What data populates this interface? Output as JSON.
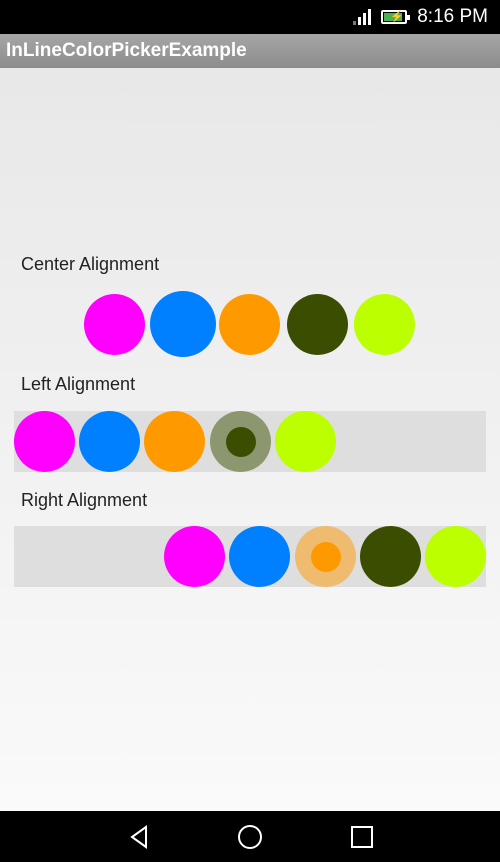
{
  "status_bar": {
    "time": "8:16 PM",
    "icons": [
      "signal-icon",
      "battery-charging-icon"
    ]
  },
  "app_bar": {
    "title": "InLineColorPickerExample"
  },
  "sections": [
    {
      "label": "Center Alignment",
      "alignment": "center",
      "colors": [
        "#ff00ff",
        "#0080ff",
        "#ff9900",
        "#3a4d00",
        "#bbff00"
      ],
      "selected": 1
    },
    {
      "label": "Left Alignment",
      "alignment": "left",
      "colors": [
        "#ff00ff",
        "#0080ff",
        "#ff9900",
        "#3a4d00",
        "#bbff00"
      ],
      "selected": 3
    },
    {
      "label": "Right Alignment",
      "alignment": "right",
      "colors": [
        "#ff00ff",
        "#0080ff",
        "#ff9900",
        "#3a4d00",
        "#bbff00"
      ],
      "selected": 2
    }
  ],
  "nav_bar": {
    "buttons": [
      "back-icon",
      "home-icon",
      "recents-icon"
    ]
  }
}
